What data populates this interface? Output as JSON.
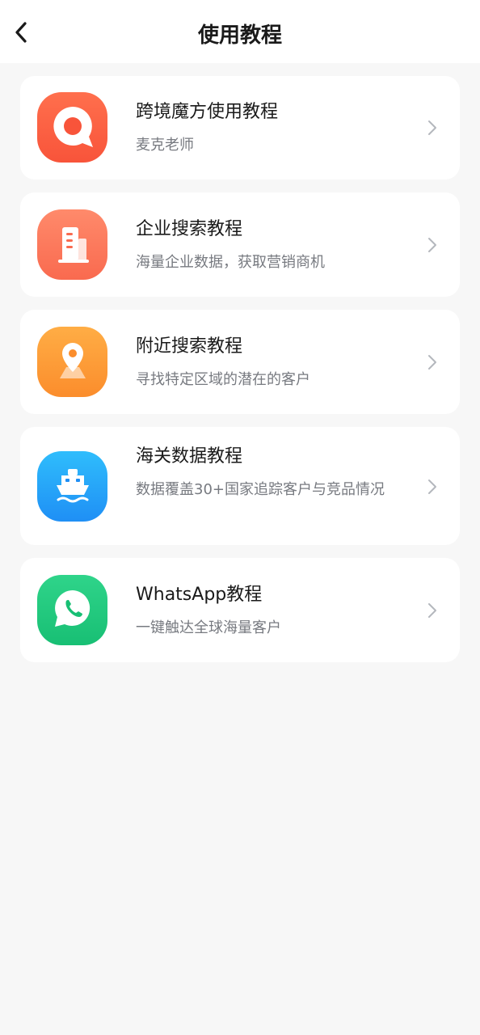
{
  "header": {
    "back_icon": "chevron-left-icon",
    "title": "使用教程"
  },
  "items": [
    {
      "title": "跨境魔方使用教程",
      "subtitle": "麦克老师",
      "icon": "chat-bubble-icon",
      "color_top": "#ff6f4d",
      "color_bottom": "#f8543a"
    },
    {
      "title": "企业搜索教程",
      "subtitle": "海量企业数据，获取营销商机",
      "icon": "building-icon",
      "color_top": "#ff8a6b",
      "color_bottom": "#f96a4f"
    },
    {
      "title": "附近搜索教程",
      "subtitle": "寻找特定区域的潜在的客户",
      "icon": "location-pin-icon",
      "color_top": "#ffad45",
      "color_bottom": "#fb8d2c"
    },
    {
      "title": "海关数据教程",
      "subtitle": "数据覆盖30+国家追踪客户与竞品情况",
      "icon": "ship-icon",
      "color_top": "#2fbdfc",
      "color_bottom": "#1f8ff5"
    },
    {
      "title": "WhatsApp教程",
      "subtitle": "一键触达全球海量客户",
      "icon": "whatsapp-icon",
      "color_top": "#2fd48a",
      "color_bottom": "#18bf74"
    }
  ]
}
